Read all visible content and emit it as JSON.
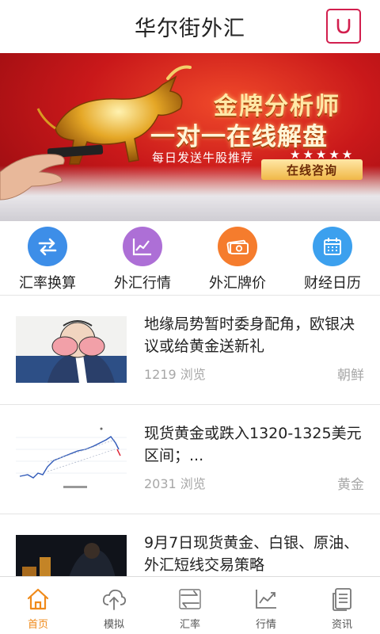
{
  "header": {
    "title": "华尔街外汇"
  },
  "banner": {
    "line1": "金牌分析师",
    "line2": "一对一在线解盘",
    "subtitle": "每日发送牛股推荐",
    "stars": "★★★★★",
    "cta": "在线咨询"
  },
  "quick_nav": [
    {
      "label": "汇率换算",
      "icon": "exchange-arrows-icon",
      "color": "#3d8ee8"
    },
    {
      "label": "外汇行情",
      "icon": "trend-chart-icon",
      "color": "#ad6fd6"
    },
    {
      "label": "外汇牌价",
      "icon": "banknote-icon",
      "color": "#f57c2d"
    },
    {
      "label": "财经日历",
      "icon": "calendar-icon",
      "color": "#3ca0ee"
    }
  ],
  "news": [
    {
      "title": "地缘局势暂时委身配角，欧银决议或给黄金送新礼",
      "views": "1219 浏览",
      "tag": "朝鲜"
    },
    {
      "title": "现货黄金或跌入1320-1325美元区间；...",
      "views": "2031 浏览",
      "tag": "黄金"
    },
    {
      "title": "9月7日现货黄金、白银、原油、外汇短线交易策略",
      "views": "",
      "tag": ""
    }
  ],
  "tabs": [
    {
      "label": "首页",
      "icon": "home-icon",
      "active": true
    },
    {
      "label": "模拟",
      "icon": "cloud-upload-icon",
      "active": false
    },
    {
      "label": "汇率",
      "icon": "exchange-icon",
      "active": false
    },
    {
      "label": "行情",
      "icon": "chart-icon",
      "active": false
    },
    {
      "label": "资讯",
      "icon": "document-icon",
      "active": false
    }
  ],
  "colors": {
    "accent": "#f08a1a",
    "brand": "#d21f4e",
    "banner": "#c9181a"
  }
}
